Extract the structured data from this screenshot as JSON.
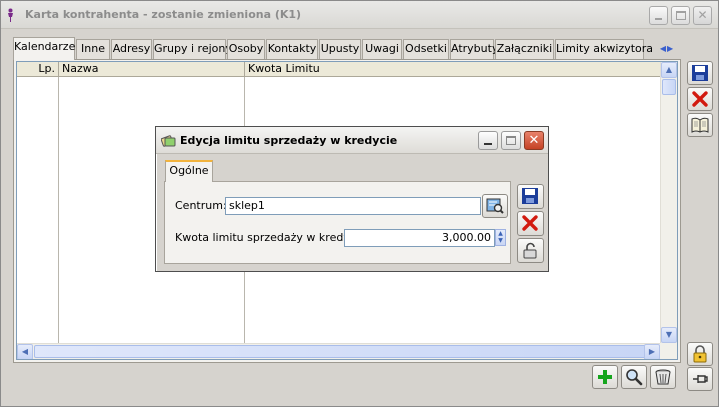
{
  "window": {
    "title": "Karta kontrahenta - zostanie zmieniona (K1)"
  },
  "tabs": [
    {
      "label": "Kalendarze"
    },
    {
      "label": "Inne"
    },
    {
      "label": "Adresy"
    },
    {
      "label": "Grupy i rejony"
    },
    {
      "label": "Osoby"
    },
    {
      "label": "Kontakty"
    },
    {
      "label": "Upusty"
    },
    {
      "label": "Uwagi"
    },
    {
      "label": "Odsetki"
    },
    {
      "label": "Atrybuty"
    },
    {
      "label": "Załączniki"
    },
    {
      "label": "Limity akwizytora"
    }
  ],
  "grid": {
    "columns": [
      "Lp.",
      "Nazwa",
      "Kwota Limitu"
    ]
  },
  "dialog": {
    "title": "Edycja limitu sprzedaży w kredycie",
    "tab": "Ogólne",
    "centrum_label": "Centrum:",
    "centrum_value": "sklep1",
    "kwota_label": "Kwota limitu sprzedaży w kredycie:",
    "kwota_value": "3,000.00"
  },
  "colors": {
    "accent_tab": "#f2b33d",
    "close_red": "#c54225",
    "add_green": "#16a51d"
  },
  "icons": [
    "save-icon",
    "cancel-icon",
    "book-icon",
    "lock-icon",
    "pin-icon",
    "add-icon",
    "search-icon",
    "trash-icon",
    "lookup-icon"
  ]
}
